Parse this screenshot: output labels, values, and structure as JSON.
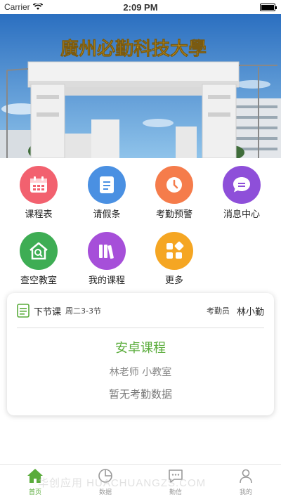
{
  "status_bar": {
    "carrier": "Carrier",
    "time": "2:09 PM"
  },
  "banner": {
    "school_name": "廣州必勤科技大學",
    "alt": "campus-gate-photo"
  },
  "grid": {
    "items": [
      {
        "label": "课程表",
        "icon": "calendar-icon",
        "color": "#f2616f"
      },
      {
        "label": "请假条",
        "icon": "document-icon",
        "color": "#4a90e2"
      },
      {
        "label": "考勤预警",
        "icon": "clock-icon",
        "color": "#f57c4b"
      },
      {
        "label": "消息中心",
        "icon": "chat-icon",
        "color": "#8e4fd9"
      },
      {
        "label": "查空教室",
        "icon": "search-room-icon",
        "color": "#3ead54"
      },
      {
        "label": "我的课程",
        "icon": "books-icon",
        "color": "#a64fd9"
      },
      {
        "label": "更多",
        "icon": "grid-apps-icon",
        "color": "#f5a623"
      }
    ]
  },
  "card": {
    "title": "下节课",
    "subtitle": "周二3-3节",
    "role_label": "考勤员",
    "person": "林小勤",
    "course": "安卓课程",
    "teacher_room": "林老师  小教室",
    "status": "暂无考勤数据"
  },
  "tabbar": {
    "tabs": [
      {
        "label": "首页",
        "icon": "home-icon",
        "active": true
      },
      {
        "label": "数据",
        "icon": "chart-pie-icon",
        "active": false
      },
      {
        "label": "勤信",
        "icon": "message-icon",
        "active": false
      },
      {
        "label": "我的",
        "icon": "user-icon",
        "active": false
      }
    ]
  },
  "watermark": "华创应用 HUACHUANGZS.COM",
  "colors": {
    "accent": "#5aac3b",
    "inactive": "#999999"
  }
}
